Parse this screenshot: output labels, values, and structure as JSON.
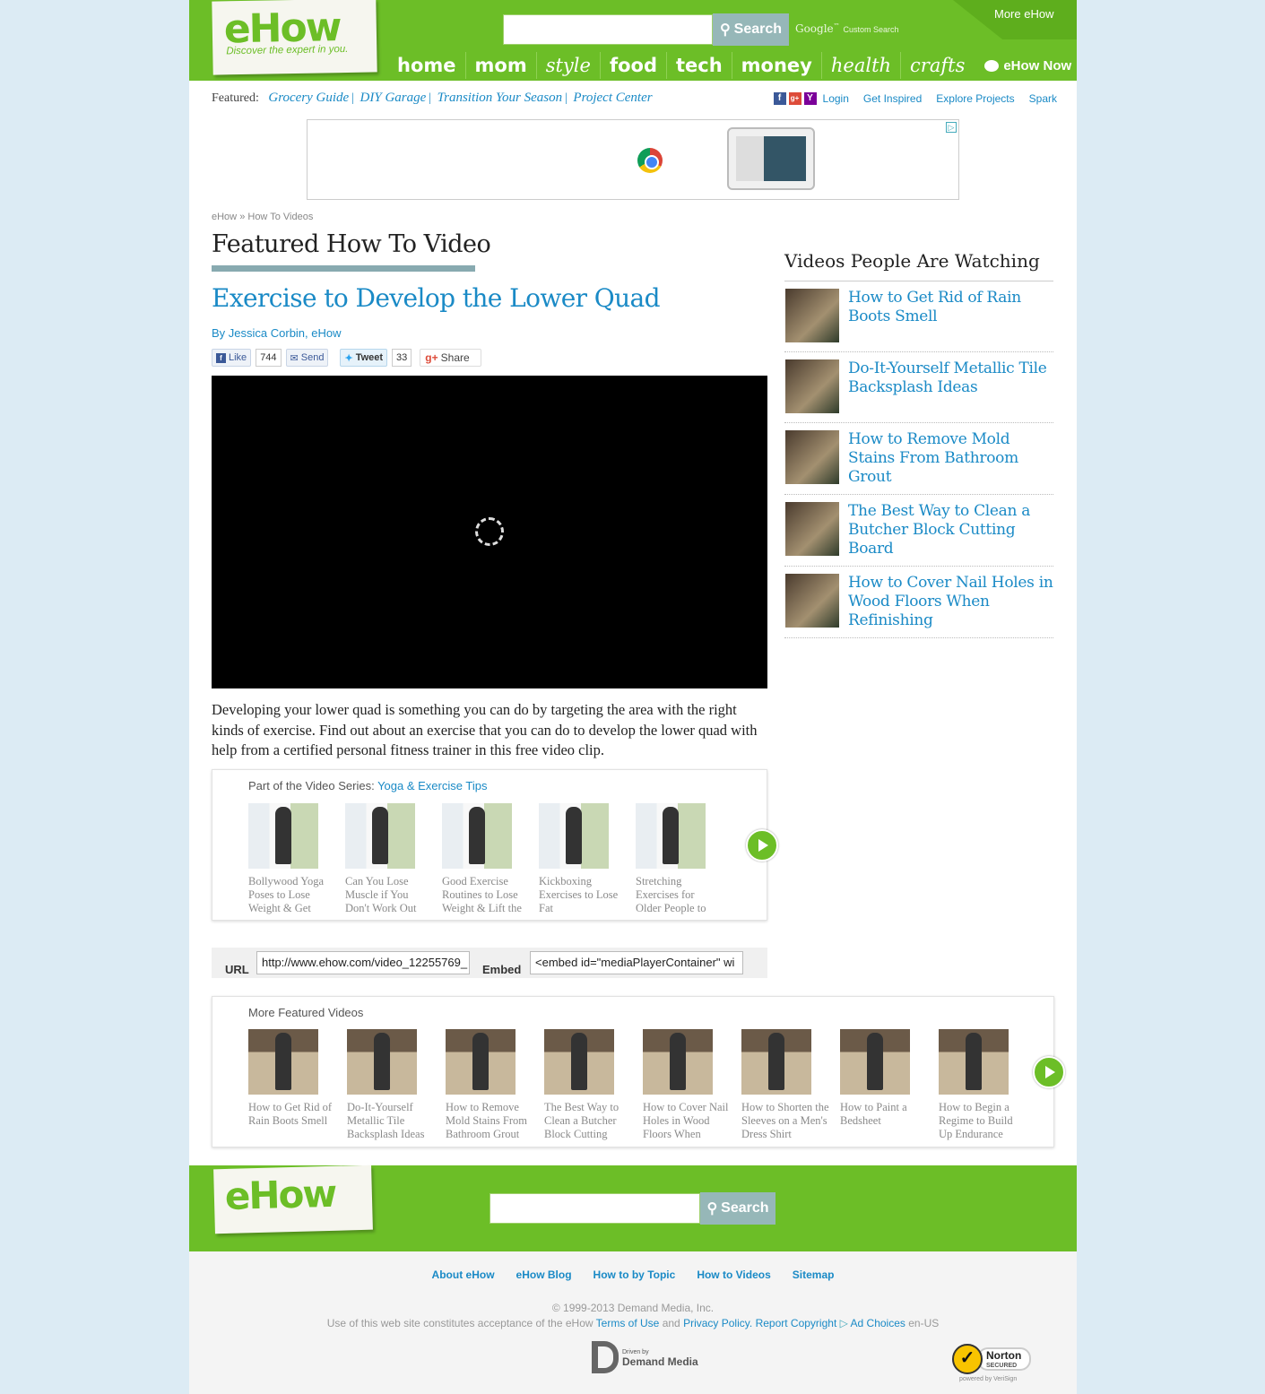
{
  "header": {
    "logo_main": "eHow",
    "logo_tagline": "Discover the expert in you.",
    "search_button": "Search",
    "search_value": "",
    "google_label": "Google",
    "custom_search_label": "Custom Search",
    "more_ehow": "More eHow",
    "nav": [
      "home",
      "mom",
      "style",
      "food",
      "tech",
      "money",
      "health",
      "crafts"
    ],
    "ehow_now": "eHow Now"
  },
  "featured_bar": {
    "label": "Featured:",
    "links": [
      "Grocery Guide",
      "DIY Garage",
      "Transition Your Season",
      "Project Center"
    ],
    "separator": "|"
  },
  "top_links": {
    "social_icons": [
      "facebook-icon",
      "google-plus-icon",
      "yahoo-icon"
    ],
    "social_letters": [
      "f",
      "g+",
      "Y"
    ],
    "login": "Login",
    "get_inspired": "Get Inspired",
    "explore_projects": "Explore Projects",
    "spark": "Spark"
  },
  "breadcrumb": {
    "home": "eHow",
    "separator": "»",
    "current": "How To Videos"
  },
  "main": {
    "section_title": "Featured How To Video",
    "article_title": "Exercise to Develop the Lower Quad",
    "byline": "By Jessica Corbin, eHow",
    "share": {
      "like_label": "Like",
      "like_count": "744",
      "send_label": "Send",
      "tweet_label": "Tweet",
      "tweet_count": "33",
      "share_label": "Share"
    },
    "description": "Developing your lower quad is something you can do by targeting the area with the right kinds of exercise. Find out about an exercise that you can do to develop the lower quad with help from a certified personal fitness trainer in this free video clip.",
    "series": {
      "prefix": "Part of the Video Series:",
      "name": "Yoga & Exercise Tips",
      "items": [
        "Bollywood Yoga Poses to Lose Weight & Get",
        "Can You Lose Muscle if You Don't Work Out",
        "Good Exercise Routines to Lose Weight & Lift the",
        "Kickboxing Exercises to Lose Fat",
        "Stretching Exercises for Older People to"
      ]
    },
    "url_label": "URL",
    "url_value": "http://www.ehow.com/video_12255769_",
    "embed_label": "Embed",
    "embed_value": "<embed id=\"mediaPlayerContainer\" wi"
  },
  "more_featured": {
    "title": "More Featured Videos",
    "items": [
      "How to Get Rid of Rain Boots Smell",
      "Do-It-Yourself Metallic Tile Backsplash Ideas",
      "How to Remove Mold Stains From Bathroom Grout",
      "The Best Way to Clean a Butcher Block Cutting",
      "How to Cover Nail Holes in Wood Floors When",
      "How to Shorten the Sleeves on a Men's Dress Shirt",
      "How to Paint a Bedsheet",
      "How to Begin a Regime to Build Up Endurance"
    ]
  },
  "sidebar": {
    "title": "Videos People Are Watching",
    "items": [
      "How to Get Rid of Rain Boots Smell",
      "Do-It-Yourself Metallic Tile Backsplash Ideas",
      "How to Remove Mold Stains From Bathroom Grout",
      "The Best Way to Clean a Butcher Block Cutting Board",
      "How to Cover Nail Holes in Wood Floors When Refinishing"
    ]
  },
  "footer": {
    "logo_main": "eHow",
    "search_button": "Search",
    "links": [
      "About eHow",
      "eHow Blog",
      "How to by Topic",
      "How to Videos",
      "Sitemap"
    ],
    "copyright": "© 1999-2013 Demand Media, Inc.",
    "terms_prefix": "Use of this web site constitutes acceptance of the eHow",
    "terms_of_use": "Terms of Use",
    "and": "and",
    "privacy_policy": "Privacy Policy.",
    "report_copyright": "Report Copyright",
    "ad_choices": "Ad Choices",
    "locale": "en-US",
    "demand_media_top": "Driven by",
    "demand_media_name": "Demand Media",
    "norton_name": "Norton",
    "norton_sub": "SECURED",
    "norton_powered": "powered by VeriSign"
  },
  "colors": {
    "brand_green": "#6cbe27",
    "link_blue": "#1a8ac6",
    "search_button": "#96b7b8"
  }
}
